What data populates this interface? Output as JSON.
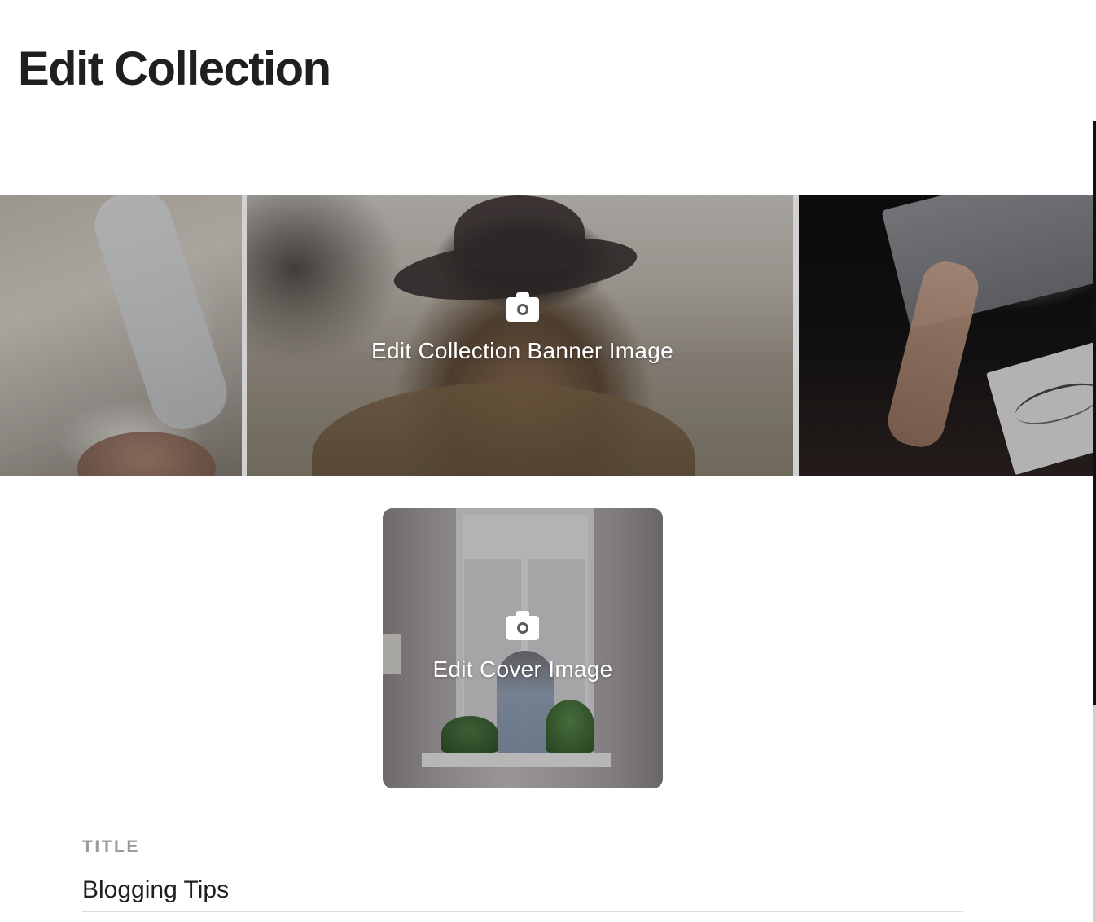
{
  "page": {
    "title": "Edit Collection"
  },
  "banner": {
    "label": "Edit Collection Banner Image",
    "icon": "camera-icon"
  },
  "cover": {
    "label": "Edit Cover Image",
    "icon": "camera-icon"
  },
  "form": {
    "title_label": "TITLE",
    "title_value": "Blogging Tips"
  },
  "colors": {
    "text": "#1f1f1f",
    "label_gray": "#9a9a9a",
    "divider": "#dcdcdc",
    "overlay_text": "#ffffff"
  }
}
